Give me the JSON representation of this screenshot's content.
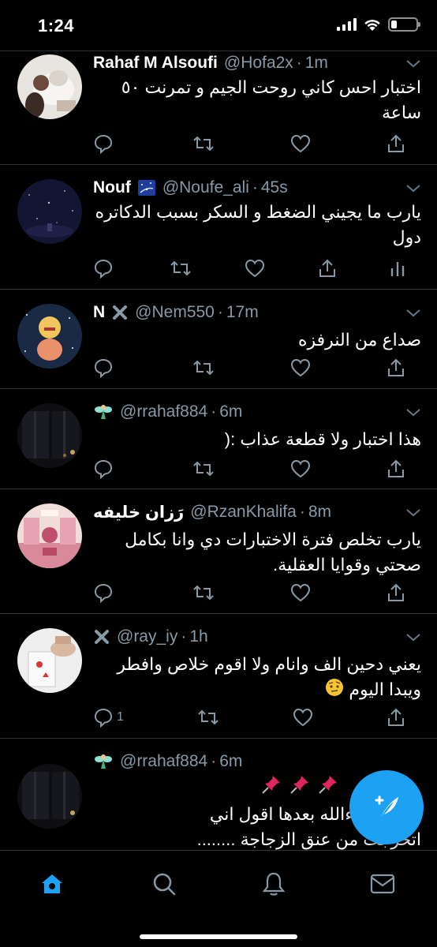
{
  "status_bar": {
    "time": "1:24"
  },
  "colors": {
    "accent": "#1da1f2",
    "muted": "#8899a6",
    "divider": "#2f3336",
    "pin": "#e0245e"
  },
  "tweets": [
    {
      "name": "Rahaf M Alsoufi",
      "handle": "@Hofa2x",
      "age": "1m",
      "text": "اختبار احس كاني روحت الجيم و تمرنت ٥٠ ساعة",
      "reply_count": "",
      "avatar": "photo-woman-with-cat"
    },
    {
      "name": "Nouf",
      "name_badge": "galaxy-emoji",
      "handle": "@Noufe_ali",
      "age": "45s",
      "text": "يارب ما يجيني الضغط و السكر بسبب الدكاتره دول",
      "reply_count": "",
      "avatar": "night-sky"
    },
    {
      "name": "N",
      "name_badge": "x-emoji",
      "handle": "@Nem550",
      "age": "17m",
      "text": "صداع من النرفزه",
      "reply_count": "",
      "avatar": "cartoon-girl-night"
    },
    {
      "name": "",
      "name_badge": "fairy-emoji",
      "handle": "@rrahaf884",
      "age": "6m",
      "text": "هذا اختبار ولا قطعة عذاب :(",
      "reply_count": "",
      "avatar": "dark-window"
    },
    {
      "name": "رَزان خليفه",
      "handle": "@RzanKhalifa",
      "age": "8m",
      "text": "يارب تخلص فترة الاختبارات دي وانا بكامل صحتي وقوايا العقلية.",
      "reply_count": "",
      "avatar": "pink-room"
    },
    {
      "name": "",
      "name_badge": "x-emoji",
      "handle": "@ray_iy",
      "age": "1h",
      "text": "يعني دحين الف وانام ولا اقوم خلاص وافطر",
      "text2": "ويبدا اليوم",
      "text2_emoji": "raised-eyebrow-emoji",
      "reply_count": "1",
      "avatar": "hand-with-cards"
    },
    {
      "name": "",
      "name_badge": "fairy-emoji",
      "handle": "@rrahaf884",
      "age": "6m",
      "text_emoji": "pushpin-emoji",
      "text": "ن وان شاءالله بعدها اقول اني",
      "text2": "اتخرجت من عنق الزجاجة ........",
      "reply_count": "",
      "avatar": "dark-window"
    }
  ],
  "tabs": [
    "home-icon",
    "search-icon",
    "notifications-icon",
    "messages-icon"
  ],
  "fab_icon": "compose-icon"
}
